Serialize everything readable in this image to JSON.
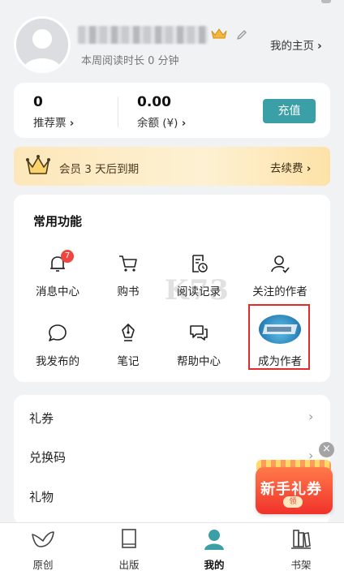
{
  "profile": {
    "read_time": "本周阅读时长 0 分钟",
    "homepage_label": "我的主页",
    "chevron": "›"
  },
  "stats": {
    "recommend_votes_value": "0",
    "recommend_votes_label": "推荐票",
    "balance_value": "0.00",
    "balance_label": "余额 (¥)",
    "recharge_label": "充值"
  },
  "membership": {
    "text": "会员 3 天后到期",
    "renew_label": "去续费"
  },
  "functions": {
    "title": "常用功能",
    "items": [
      {
        "label": "消息中心",
        "icon": "bell-icon",
        "badge": "7"
      },
      {
        "label": "购书",
        "icon": "cart-icon"
      },
      {
        "label": "阅读记录",
        "icon": "reading-history-icon"
      },
      {
        "label": "关注的作者",
        "icon": "followed-author-icon"
      },
      {
        "label": "我发布的",
        "icon": "comment-bubble-icon"
      },
      {
        "label": "笔记",
        "icon": "pen-nib-icon"
      },
      {
        "label": "帮助中心",
        "icon": "help-chat-icon"
      },
      {
        "label": "成为作者",
        "icon": "author-avatar-icon"
      }
    ]
  },
  "watermark": "K73",
  "list": {
    "items": [
      {
        "label": "礼券"
      },
      {
        "label": "兑换码"
      },
      {
        "label": "礼物"
      }
    ]
  },
  "promo": {
    "text": "新手礼券",
    "tab": "领",
    "close": "×"
  },
  "tabbar": {
    "items": [
      {
        "label": "原创",
        "icon": "bird-icon"
      },
      {
        "label": "出版",
        "icon": "book-icon"
      },
      {
        "label": "我的",
        "icon": "profile-icon",
        "active": true
      },
      {
        "label": "书架",
        "icon": "bookshelf-icon"
      }
    ]
  },
  "colors": {
    "accent": "#3a9fa6",
    "badge": "#f0453f",
    "highlight": "#e02b2b",
    "promo": "#f0322b"
  }
}
